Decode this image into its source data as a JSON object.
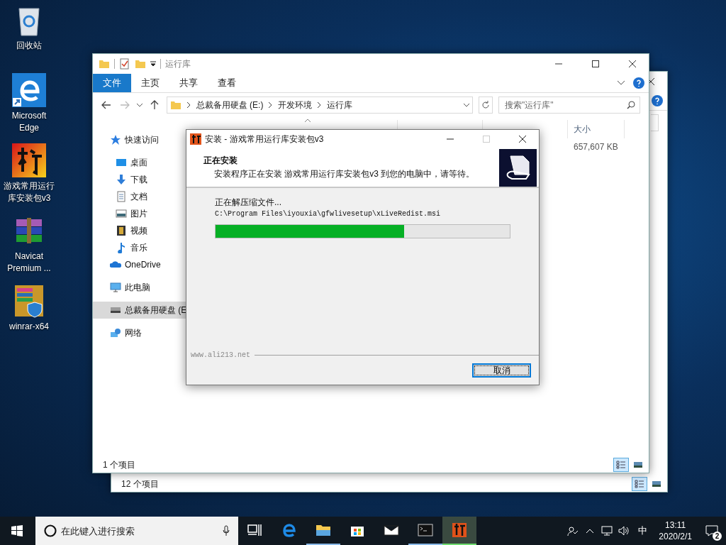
{
  "desktop_icons": [
    {
      "label": "回收站",
      "kind": "recycle"
    },
    {
      "label": "Microsoft Edge",
      "kind": "edge"
    },
    {
      "label": "游戏常用运行库安装包v3",
      "kind": "game"
    },
    {
      "label": "Navicat Premium ...",
      "kind": "rar"
    },
    {
      "label": "winrar-x64",
      "kind": "rarsetup"
    }
  ],
  "back_window": {
    "status": "12 个项目",
    "view_buttons": [
      {
        "kind": "details",
        "selected": true
      },
      {
        "kind": "thumbnails",
        "selected": false
      }
    ]
  },
  "explorer": {
    "title": "运行库",
    "ribbon_tabs": [
      {
        "label": "文件",
        "selected": true
      },
      {
        "label": "主页",
        "selected": false
      },
      {
        "label": "共享",
        "selected": false
      },
      {
        "label": "查看",
        "selected": false
      }
    ],
    "breadcrumb": [
      "总裁备用硬盘 (E:)",
      "开发环境",
      "运行库"
    ],
    "search": {
      "placeholder": "搜索\"运行库\""
    },
    "nav": [
      {
        "label": "快速访问",
        "kind": "star",
        "selected": false,
        "children": [
          {
            "label": "桌面",
            "kind": "desktop",
            "selected": false
          },
          {
            "label": "下载",
            "kind": "download",
            "selected": false
          },
          {
            "label": "文档",
            "kind": "document",
            "selected": false
          },
          {
            "label": "图片",
            "kind": "picture",
            "selected": false
          },
          {
            "label": "视频",
            "kind": "video",
            "selected": false
          },
          {
            "label": "音乐",
            "kind": "music",
            "selected": false
          }
        ]
      },
      {
        "label": "OneDrive",
        "kind": "cloud",
        "selected": false
      },
      {
        "label": "此电脑",
        "kind": "pc",
        "selected": false
      },
      {
        "label": "总裁备用硬盘 (E",
        "kind": "drive",
        "selected": true
      },
      {
        "label": "网络",
        "kind": "network",
        "selected": false
      }
    ],
    "size_column": "大小",
    "rows": [
      {
        "size": "657,607 KB"
      }
    ],
    "status": "1 个项目",
    "view_buttons": [
      {
        "kind": "details",
        "selected": true
      },
      {
        "kind": "thumbnails",
        "selected": false
      }
    ]
  },
  "dialog": {
    "title": "安装 - 游戏常用运行库安装包v3",
    "heading": "正在安装",
    "subheading": "安装程序正在安装 游戏常用运行库安装包v3 到您的电脑中，请等待。",
    "status": "正在解压缩文件...",
    "path": "C:\\Program Files\\iyouxia\\gfwlivesetup\\xLiveRedist.msi",
    "progress": {
      "level": 0.64
    },
    "brand": "www.ali213.net",
    "cancel": "取消"
  },
  "taskbar": {
    "search": {
      "placeholder": "在此键入进行搜索"
    },
    "apps": [
      {
        "kind": "taskview",
        "running": false,
        "selected": false
      },
      {
        "kind": "edge",
        "running": false,
        "selected": false
      },
      {
        "kind": "explorer",
        "running": true,
        "selected": false
      },
      {
        "kind": "store",
        "running": false,
        "selected": false
      },
      {
        "kind": "mail",
        "running": false,
        "selected": false
      },
      {
        "kind": "terminal",
        "running": true,
        "selected": false
      },
      {
        "kind": "game",
        "running": true,
        "selected": true
      }
    ],
    "ime": "中",
    "time": "13:11",
    "date": "2020/2/1",
    "notifications": "2"
  }
}
